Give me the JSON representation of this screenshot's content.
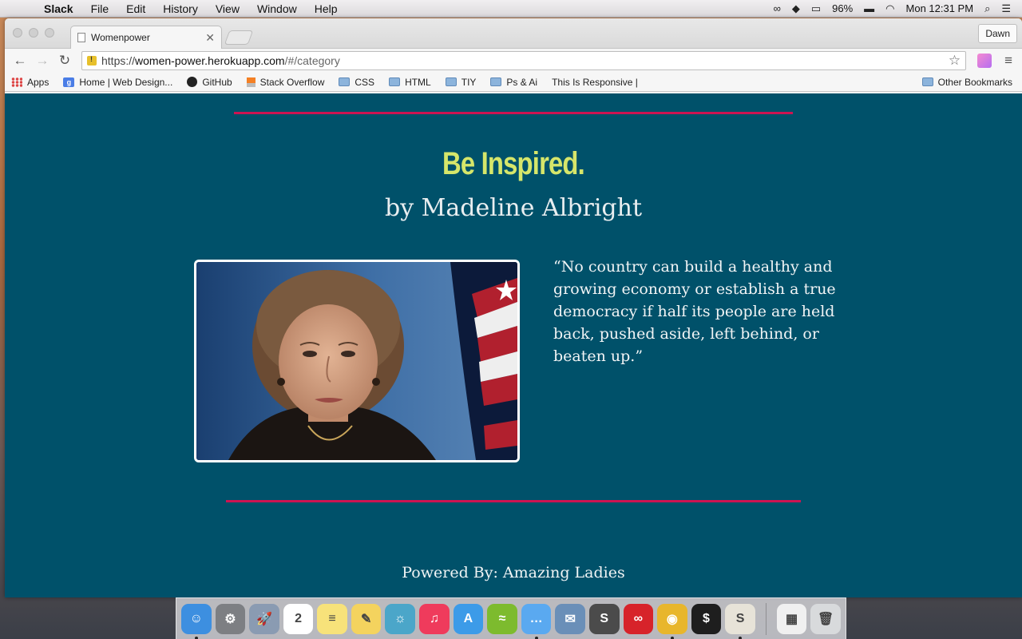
{
  "menubar": {
    "app_name": "Slack",
    "menus": [
      "File",
      "Edit",
      "History",
      "View",
      "Window",
      "Help"
    ],
    "battery": "96%",
    "clock": "Mon 12:31 PM"
  },
  "browser": {
    "tab_title": "Womenpower",
    "profile": "Dawn",
    "url": {
      "scheme": "https://",
      "host": "women-power.herokuapp.com",
      "path": "/#/category"
    },
    "bookmarks": [
      {
        "label": "Apps",
        "icon": "apps-grid-icon"
      },
      {
        "label": "Home | Web Design...",
        "icon": "google-icon"
      },
      {
        "label": "GitHub",
        "icon": "github-icon"
      },
      {
        "label": "Stack Overflow",
        "icon": "stackoverflow-icon"
      },
      {
        "label": "CSS",
        "icon": "folder-icon"
      },
      {
        "label": "HTML",
        "icon": "folder-icon"
      },
      {
        "label": "TIY",
        "icon": "folder-icon"
      },
      {
        "label": "Ps & Ai",
        "icon": "folder-icon"
      },
      {
        "label": "This Is Responsive |",
        "icon": "page-icon"
      }
    ],
    "other_bookmarks": "Other Bookmarks"
  },
  "content": {
    "heading": "Be Inspired.",
    "byline": "by Madeline Albright",
    "quote": "“No country can build a healthy and growing economy or establish a true democracy if half its people are held back, pushed aside, left behind, or beaten up.”",
    "footer": "Powered By: Amazing Ladies",
    "colors": {
      "background": "#00516a",
      "accent_rule": "#cd1452",
      "heading": "#d6e66a"
    }
  },
  "dock": {
    "apps": [
      {
        "name": "finder",
        "color": "#3d8fe0",
        "glyph": "☺",
        "running": true
      },
      {
        "name": "system-preferences",
        "color": "#7d7f83",
        "glyph": "⚙",
        "running": false
      },
      {
        "name": "launchpad",
        "color": "#8a9bb2",
        "glyph": "🚀",
        "running": false
      },
      {
        "name": "calendar",
        "color": "#ffffff",
        "glyph": "2",
        "running": false
      },
      {
        "name": "notes",
        "color": "#f7e27a",
        "glyph": "≡",
        "running": false
      },
      {
        "name": "stickies",
        "color": "#f4d35e",
        "glyph": "✎",
        "running": false
      },
      {
        "name": "photos",
        "color": "#4ba6c9",
        "glyph": "☼",
        "running": false
      },
      {
        "name": "itunes",
        "color": "#ef3b5c",
        "glyph": "♫",
        "running": false
      },
      {
        "name": "app-store",
        "color": "#3c9be8",
        "glyph": "A",
        "running": false
      },
      {
        "name": "spotify",
        "color": "#7dbb2e",
        "glyph": "≈",
        "running": false
      },
      {
        "name": "messages",
        "color": "#5aa9f0",
        "glyph": "…",
        "running": true
      },
      {
        "name": "preview",
        "color": "#6a8fb8",
        "glyph": "✉",
        "running": false
      },
      {
        "name": "sublime-text",
        "color": "#4b4b4b",
        "glyph": "S",
        "running": false
      },
      {
        "name": "creative-cloud",
        "color": "#d7232a",
        "glyph": "∞",
        "running": false
      },
      {
        "name": "chrome",
        "color": "#e8b62c",
        "glyph": "◉",
        "running": true
      },
      {
        "name": "terminal",
        "color": "#1e1e1e",
        "glyph": "$",
        "running": false
      },
      {
        "name": "slack",
        "color": "#e7e3d8",
        "glyph": "S",
        "running": true
      }
    ],
    "right_apps": [
      {
        "name": "downloads-stack",
        "color": "#f0f0f0",
        "glyph": "▦"
      },
      {
        "name": "trash",
        "color": "#d8dadc",
        "glyph": "🗑"
      }
    ]
  }
}
